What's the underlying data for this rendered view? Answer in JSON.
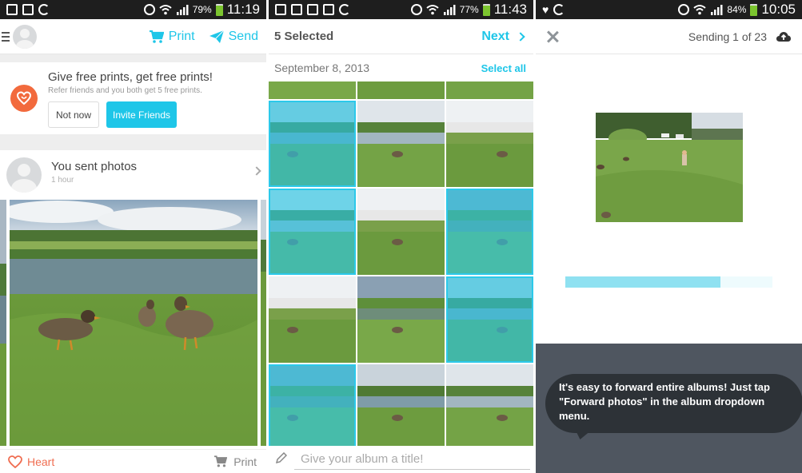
{
  "panel1": {
    "status": {
      "battery": "79%",
      "time": "11:19"
    },
    "header": {
      "print_label": "Print",
      "send_label": "Send"
    },
    "promo": {
      "title": "Give free prints, get free prints!",
      "subtitle": "Refer friends and you both get 5 free prints.",
      "not_now": "Not now",
      "invite": "Invite Friends"
    },
    "feed": {
      "title": "You sent photos",
      "time": "1 hour"
    },
    "footer": {
      "heart": "Heart",
      "print": "Print"
    }
  },
  "panel2": {
    "status": {
      "battery": "77%",
      "time": "11:43"
    },
    "header": {
      "selected": "5 Selected",
      "next": "Next"
    },
    "section": {
      "date": "September 8, 2013",
      "select_all": "Select all"
    },
    "grid": {
      "rows": [
        {
          "top": true,
          "cells": [
            false,
            false,
            false
          ]
        },
        {
          "cells": [
            true,
            false,
            false
          ]
        },
        {
          "cells": [
            true,
            false,
            true
          ]
        },
        {
          "cells": [
            false,
            false,
            true
          ]
        },
        {
          "cells": [
            true,
            false,
            false
          ]
        }
      ]
    },
    "footer": {
      "placeholder": "Give your album a title!"
    }
  },
  "panel3": {
    "status": {
      "battery": "84%",
      "time": "10:05"
    },
    "header": {
      "sending": "Sending 1 of 23"
    },
    "progress": 0.75,
    "tip": "It's easy to forward entire albums! Just tap \"Forward photos\" in the album dropdown menu."
  },
  "colors": {
    "accent": "#1ec6e8",
    "heart": "#f06e52",
    "logo": "#f26a3d",
    "status_bar": "#1e1e1e",
    "tip_background": "#4f5660"
  }
}
